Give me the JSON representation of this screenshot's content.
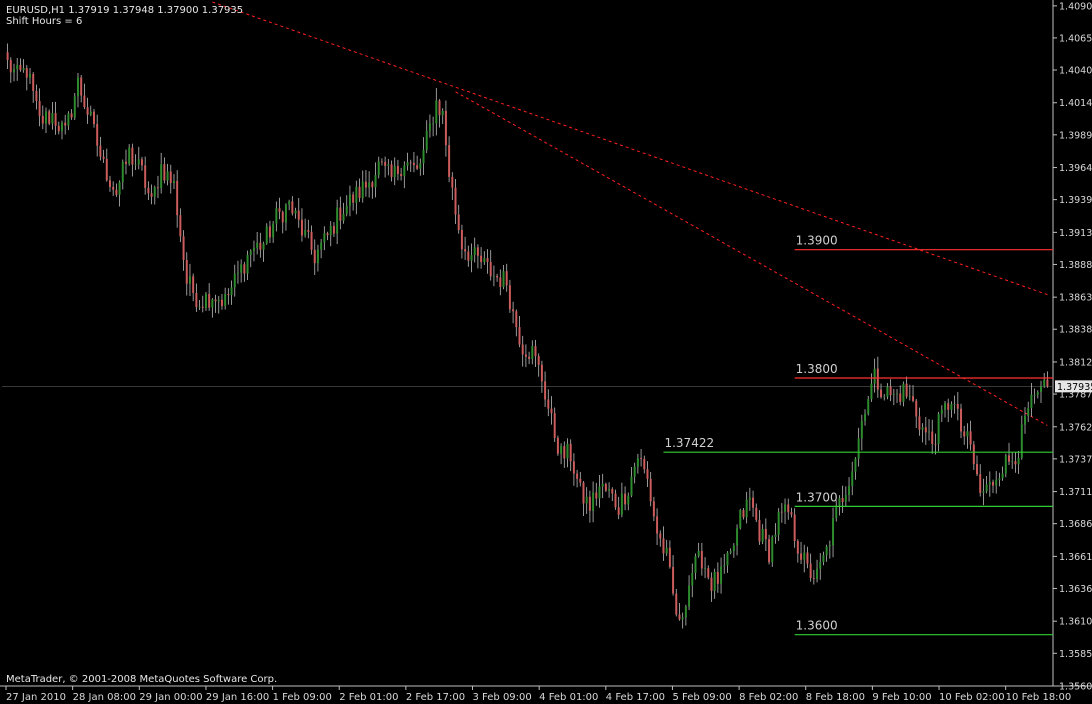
{
  "header": {
    "symbol_line": "EURUSD,H1  1.37919 1.37948 1.37900 1.37935",
    "indicator_line": "Shift Hours = 6"
  },
  "footer": {
    "copyright": "MetaTrader, © 2001-2008 MetaQuotes Software Corp."
  },
  "colors": {
    "background": "#000000",
    "frame": "#c0c0c0",
    "bull_candle": "#2e8b2e",
    "bear_candle": "#cd5c5c",
    "wick": "#bdbdbd",
    "support_line": "#32cd32",
    "resistance_line": "#ff3030",
    "trendline": "#ff2020",
    "text": "#d8d8d8"
  },
  "chart_data": {
    "type": "candlestick",
    "symbol": "EURUSD",
    "timeframe": "H1",
    "current_price": "1.37935",
    "ylim": [
      1.356,
      1.4093
    ],
    "y_ticks": [
      "1.40900",
      "1.40650",
      "1.40400",
      "1.40145",
      "1.39895",
      "1.39640",
      "1.39390",
      "1.39135",
      "1.38885",
      "1.38630",
      "1.38380",
      "1.38125",
      "1.37875",
      "1.37620",
      "1.37370",
      "1.37115",
      "1.36865",
      "1.36610",
      "1.36360",
      "1.36105",
      "1.35855",
      "1.35600"
    ],
    "x_ticks": [
      "27 Jan 2010",
      "28 Jan 08:00",
      "29 Jan 00:00",
      "29 Jan 16:00",
      "1 Feb 09:00",
      "2 Feb 01:00",
      "2 Feb 17:00",
      "3 Feb 09:00",
      "4 Feb 01:00",
      "4 Feb 17:00",
      "5 Feb 09:00",
      "8 Feb 02:00",
      "8 Feb 18:00",
      "9 Feb 10:00",
      "10 Feb 02:00",
      "10 Feb 18:00"
    ],
    "price_path": [
      [
        0,
        1.4045
      ],
      [
        3,
        1.4035
      ],
      [
        6,
        1.404
      ],
      [
        10,
        1.4
      ],
      [
        14,
        1.4005
      ],
      [
        18,
        1.399
      ],
      [
        22,
        1.403
      ],
      [
        26,
        1.4
      ],
      [
        30,
        1.3965
      ],
      [
        34,
        1.3945
      ],
      [
        38,
        1.3975
      ],
      [
        42,
        1.396
      ],
      [
        45,
        1.3935
      ],
      [
        48,
        1.3965
      ],
      [
        52,
        1.395
      ],
      [
        56,
        1.3875
      ],
      [
        60,
        1.386
      ],
      [
        64,
        1.3865
      ],
      [
        68,
        1.386
      ],
      [
        72,
        1.388
      ],
      [
        76,
        1.39
      ],
      [
        80,
        1.3905
      ],
      [
        84,
        1.3925
      ],
      [
        88,
        1.3935
      ],
      [
        92,
        1.3915
      ],
      [
        96,
        1.3895
      ],
      [
        100,
        1.391
      ],
      [
        104,
        1.393
      ],
      [
        108,
        1.394
      ],
      [
        112,
        1.395
      ],
      [
        116,
        1.3965
      ],
      [
        120,
        1.3955
      ],
      [
        124,
        1.397
      ],
      [
        128,
        1.396
      ],
      [
        130,
        1.3975
      ],
      [
        132,
        1.3995
      ],
      [
        134,
        1.4015
      ],
      [
        136,
        1.4005
      ],
      [
        138,
        1.396
      ],
      [
        140,
        1.393
      ],
      [
        142,
        1.3905
      ],
      [
        145,
        1.3895
      ],
      [
        148,
        1.389
      ],
      [
        152,
        1.388
      ],
      [
        156,
        1.3875
      ],
      [
        158,
        1.385
      ],
      [
        161,
        1.3825
      ],
      [
        164,
        1.382
      ],
      [
        167,
        1.38
      ],
      [
        170,
        1.3765
      ],
      [
        173,
        1.374
      ],
      [
        176,
        1.374
      ],
      [
        179,
        1.371
      ],
      [
        182,
        1.37
      ],
      [
        185,
        1.3715
      ],
      [
        188,
        1.371
      ],
      [
        191,
        1.37
      ],
      [
        194,
        1.3715
      ],
      [
        197,
        1.374
      ],
      [
        200,
        1.372
      ],
      [
        203,
        1.368
      ],
      [
        206,
        1.366
      ],
      [
        208,
        1.363
      ],
      [
        210,
        1.3605
      ],
      [
        212,
        1.363
      ],
      [
        214,
        1.365
      ],
      [
        217,
        1.366
      ],
      [
        220,
        1.364
      ],
      [
        223,
        1.3645
      ],
      [
        226,
        1.366
      ],
      [
        229,
        1.369
      ],
      [
        232,
        1.3705
      ],
      [
        235,
        1.368
      ],
      [
        238,
        1.3665
      ],
      [
        241,
        1.369
      ],
      [
        244,
        1.3695
      ],
      [
        247,
        1.367
      ],
      [
        250,
        1.365
      ],
      [
        253,
        1.3645
      ],
      [
        256,
        1.3665
      ],
      [
        259,
        1.3695
      ],
      [
        262,
        1.3715
      ],
      [
        265,
        1.374
      ],
      [
        268,
        1.378
      ],
      [
        271,
        1.38
      ],
      [
        274,
        1.379
      ],
      [
        277,
        1.3785
      ],
      [
        280,
        1.379
      ],
      [
        283,
        1.378
      ],
      [
        286,
        1.376
      ],
      [
        289,
        1.375
      ],
      [
        292,
        1.377
      ],
      [
        295,
        1.3785
      ],
      [
        298,
        1.376
      ],
      [
        301,
        1.3745
      ],
      [
        304,
        1.371
      ],
      [
        307,
        1.3715
      ],
      [
        310,
        1.373
      ],
      [
        313,
        1.3735
      ],
      [
        316,
        1.3745
      ],
      [
        319,
        1.3775
      ],
      [
        322,
        1.3785
      ],
      [
        324,
        1.379
      ],
      [
        325,
        1.37935
      ]
    ],
    "levels": [
      {
        "label": "1.3900",
        "value": 1.39,
        "color": "#ff3030",
        "x_start_bar": 246
      },
      {
        "label": "1.3800",
        "value": 1.38,
        "color": "#ff3030",
        "x_start_bar": 246
      },
      {
        "label": "1.37422",
        "value": 1.37422,
        "color": "#32cd32",
        "x_start_bar": 205
      },
      {
        "label": "1.3700",
        "value": 1.37,
        "color": "#32cd32",
        "x_start_bar": 246
      },
      {
        "label": "1.3600",
        "value": 1.36,
        "color": "#32cd32",
        "x_start_bar": 246
      }
    ],
    "trendlines": [
      {
        "from": [
          64,
          1.4093
        ],
        "to": [
          325,
          1.3865
        ],
        "style": "dashed"
      },
      {
        "from": [
          140,
          1.4023
        ],
        "to": [
          325,
          1.3763
        ],
        "style": "dashed"
      }
    ],
    "grid": false
  }
}
